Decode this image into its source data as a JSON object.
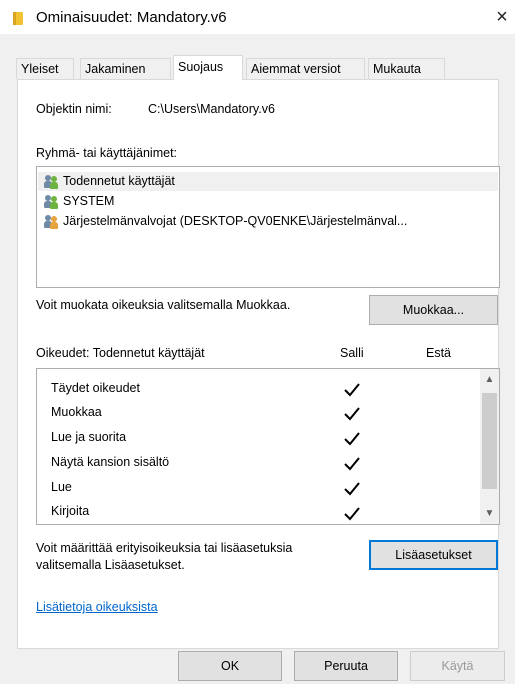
{
  "window": {
    "title": "Ominaisuudet: Mandatory.v6",
    "close_glyph": "×"
  },
  "tabs": [
    {
      "label": "Yleiset"
    },
    {
      "label": "Jakaminen"
    },
    {
      "label": "Suojaus"
    },
    {
      "label": "Aiemmat versiot"
    },
    {
      "label": "Mukauta"
    }
  ],
  "active_tab": "Suojaus",
  "security": {
    "object_name_label": "Objektin nimi:",
    "object_name_value": "C:\\Users\\Mandatory.v6",
    "groups_label": "Ryhmä- tai käyttäjänimet:",
    "groups": [
      {
        "name": "Todennetut käyttäjät",
        "icon": "users-icon"
      },
      {
        "name": "SYSTEM",
        "icon": "users-icon"
      },
      {
        "name": "Järjestelmänvalvojat (DESKTOP-QV0ENKE\\Järjestelmänval...",
        "icon": "admin-users-icon"
      }
    ],
    "edit_hint": "Voit muokata oikeuksia valitsemalla Muokkaa.",
    "edit_button": "Muokkaa...",
    "permissions_label": "Oikeudet: Todennetut käyttäjät",
    "allow_header": "Salli",
    "deny_header": "Estä",
    "permissions": [
      {
        "name": "Täydet oikeudet",
        "allow": true,
        "deny": false
      },
      {
        "name": "Muokkaa",
        "allow": true,
        "deny": false
      },
      {
        "name": "Lue ja suorita",
        "allow": true,
        "deny": false
      },
      {
        "name": "Näytä kansion sisältö",
        "allow": true,
        "deny": false
      },
      {
        "name": "Lue",
        "allow": true,
        "deny": false
      },
      {
        "name": "Kirjoita",
        "allow": true,
        "deny": false
      }
    ],
    "advanced_hint_line1": "Voit määrittää erityisoikeuksia tai lisäasetuksia",
    "advanced_hint_line2": "valitsemalla Lisäasetukset.",
    "advanced_button": "Lisäasetukset",
    "more_info_link": "Lisätietoja oikeuksista"
  },
  "footer": {
    "ok": "OK",
    "cancel": "Peruuta",
    "apply": "Käytä"
  }
}
